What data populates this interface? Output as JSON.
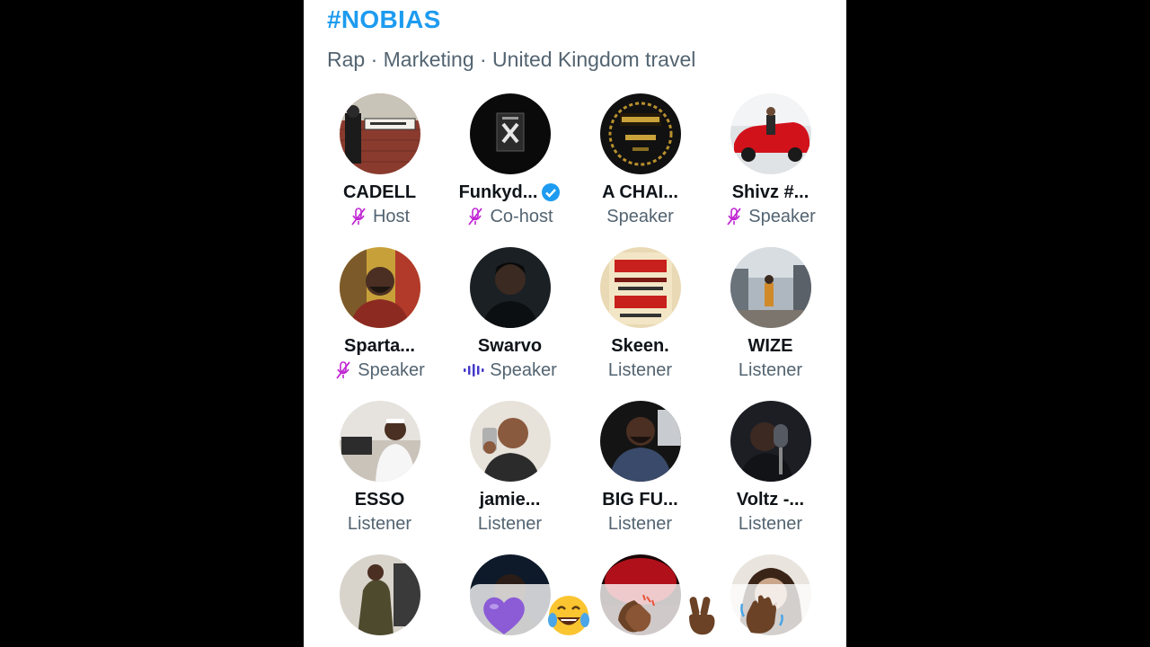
{
  "space": {
    "title": "#NOBIAS",
    "topics": "Rap · Marketing · United Kingdom travel"
  },
  "participants": [
    {
      "name": "CADELL",
      "role": "Host",
      "mic": "muted",
      "verified": false,
      "avatar": "street-sign-photo"
    },
    {
      "name": "Funkyd...",
      "role": "Co-host",
      "mic": "muted",
      "verified": true,
      "avatar": "x-logo-photo"
    },
    {
      "name": "A CHAI...",
      "role": "Speaker",
      "mic": "none",
      "verified": false,
      "avatar": "booth-of-truth-logo"
    },
    {
      "name": "Shivz #...",
      "role": "Speaker",
      "mic": "muted",
      "verified": false,
      "avatar": "red-car-photo"
    },
    {
      "name": "Sparta...",
      "role": "Speaker",
      "mic": "muted",
      "verified": false,
      "avatar": "man-red-hoodie-photo"
    },
    {
      "name": "Swarvo",
      "role": "Speaker",
      "mic": "speaking",
      "verified": false,
      "avatar": "dark-portrait-photo"
    },
    {
      "name": "Skeen.",
      "role": "Listener",
      "mic": "none",
      "verified": false,
      "avatar": "rinse-fm-poster"
    },
    {
      "name": "WIZE",
      "role": "Listener",
      "mic": "none",
      "verified": false,
      "avatar": "street-scene-photo"
    },
    {
      "name": "ESSO",
      "role": "Listener",
      "mic": "none",
      "verified": false,
      "avatar": "man-white-shirt-photo"
    },
    {
      "name": "jamie...",
      "role": "Listener",
      "mic": "none",
      "verified": false,
      "avatar": "man-phone-selfie"
    },
    {
      "name": "BIG FU...",
      "role": "Listener",
      "mic": "none",
      "verified": false,
      "avatar": "man-in-car-photo"
    },
    {
      "name": "Voltz -...",
      "role": "Listener",
      "mic": "none",
      "verified": false,
      "avatar": "man-microphone-photo"
    },
    {
      "name": "",
      "role": "",
      "mic": "none",
      "verified": false,
      "avatar": "man-standing-photo"
    },
    {
      "name": "",
      "role": "",
      "mic": "none",
      "verified": false,
      "avatar": "partial-portrait-photo"
    },
    {
      "name": "",
      "role": "",
      "mic": "none",
      "verified": false,
      "avatar": "red-light-photo"
    },
    {
      "name": "",
      "role": "",
      "mic": "none",
      "verified": false,
      "avatar": "woman-portrait-photo"
    }
  ],
  "reactions": [
    {
      "emoji": "💜",
      "name": "purple-heart-icon"
    },
    {
      "emoji": "😂",
      "name": "laughing-face-icon"
    },
    {
      "emoji": "👏🏾",
      "name": "clapping-hands-icon"
    },
    {
      "emoji": "✌🏾",
      "name": "victory-hand-icon"
    },
    {
      "emoji": "👋🏾",
      "name": "waving-hand-icon"
    }
  ],
  "colors": {
    "accent": "#1d9bf0",
    "muted_mic": "#c026d3",
    "speaking_wave": "#4338ca",
    "secondary_text": "#536471"
  }
}
